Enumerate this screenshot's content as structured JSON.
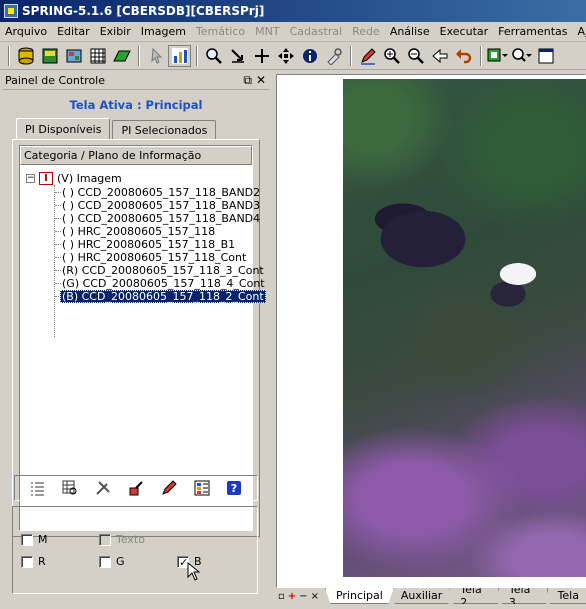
{
  "window": {
    "title": "SPRING-5.1.6 [CBERSDB][CBERSPrj]"
  },
  "menu": [
    {
      "label": "Arquivo",
      "disabled": false
    },
    {
      "label": "Editar",
      "disabled": false
    },
    {
      "label": "Exibir",
      "disabled": false
    },
    {
      "label": "Imagem",
      "disabled": false
    },
    {
      "label": "Temático",
      "disabled": true
    },
    {
      "label": "MNT",
      "disabled": true
    },
    {
      "label": "Cadastral",
      "disabled": true
    },
    {
      "label": "Rede",
      "disabled": true
    },
    {
      "label": "Análise",
      "disabled": false
    },
    {
      "label": "Executar",
      "disabled": false
    },
    {
      "label": "Ferramentas",
      "disabled": false
    },
    {
      "label": "Ajuda",
      "disabled": false
    }
  ],
  "toolbar": {
    "icons": [
      "database-icon",
      "project-icon",
      "layers-icon",
      "grid-icon",
      "parallelogram-icon",
      "cursor-icon",
      "chart-icon",
      "magnify-icon",
      "cut-icon",
      "plus-icon",
      "pan-icon",
      "info-icon",
      "tool-icon",
      "edit-pencil-icon",
      "zoom-in-icon",
      "zoom-out-icon",
      "arrow-left-icon",
      "undo-icon",
      "screen-icon",
      "query-icon",
      "window-icon"
    ]
  },
  "panel": {
    "title": "Painel de Controle",
    "active_label": "Tela Ativa : Principal",
    "tabs": [
      "PI Disponíveis",
      "PI Selecionados"
    ],
    "tree_header": "Categoria / Plano de Informação",
    "root_label": "(V) Imagem",
    "items": [
      {
        "label": "( ) CCD_20080605_157_118_BAND2",
        "selected": false
      },
      {
        "label": "( ) CCD_20080605_157_118_BAND3",
        "selected": false
      },
      {
        "label": "( ) CCD_20080605_157_118_BAND4",
        "selected": false
      },
      {
        "label": "( ) HRC_20080605_157_118",
        "selected": false
      },
      {
        "label": "( ) HRC_20080605_157_118_B1",
        "selected": false
      },
      {
        "label": "( ) HRC_20080605_157_118_Cont",
        "selected": false
      },
      {
        "label": "(R) CCD_20080605_157_118_3_Cont",
        "selected": false
      },
      {
        "label": "(G) CCD_20080605_157_118_4_Cont",
        "selected": false
      },
      {
        "label": "(B) CCD_20080605_157_118_2_Cont",
        "selected": true
      }
    ],
    "checkboxes": {
      "m": {
        "label": "M",
        "checked": false,
        "disabled": false
      },
      "texto": {
        "label": "Texto",
        "checked": false,
        "disabled": true
      },
      "r": {
        "label": "R",
        "checked": false,
        "disabled": false
      },
      "g": {
        "label": "G",
        "checked": false,
        "disabled": false
      },
      "b": {
        "label": "B",
        "checked": true,
        "disabled": false
      }
    }
  },
  "canvas": {
    "bottom_tabs": [
      "Principal",
      "Auxiliar",
      "Tela 2",
      "Tela 3",
      "Tela"
    ],
    "active_tab": "Principal"
  }
}
